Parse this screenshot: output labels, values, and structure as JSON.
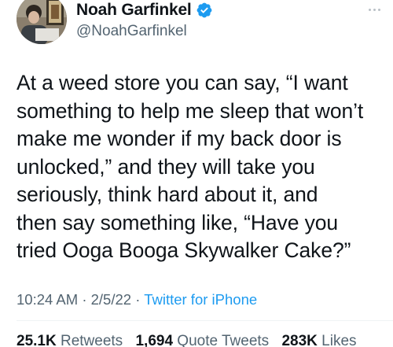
{
  "author": {
    "display_name": "Noah Garfinkel",
    "handle": "@NoahGarfinkel",
    "verified": true,
    "avatar_icon": "profile-photo"
  },
  "tweet": {
    "lines": [
      "At a weed store you can say, “I want",
      "something to help me sleep that won’t",
      "make me wonder if my back door is",
      "unlocked,” and they will take you",
      "seriously, think hard about it, and",
      "then say something like, “Have you",
      "tried Ooga Booga Skywalker Cake?”"
    ]
  },
  "meta": {
    "time": "10:24 AM",
    "separator": "·",
    "date": "2/5/22",
    "source": "Twitter for iPhone"
  },
  "stats": {
    "retweets_count": "25.1K",
    "retweets_label": "Retweets",
    "quotes_count": "1,694",
    "quotes_label": "Quote Tweets",
    "likes_count": "283K",
    "likes_label": "Likes"
  },
  "colors": {
    "accent": "#1d9bf0",
    "text": "#0f1419",
    "secondary": "#536471"
  }
}
